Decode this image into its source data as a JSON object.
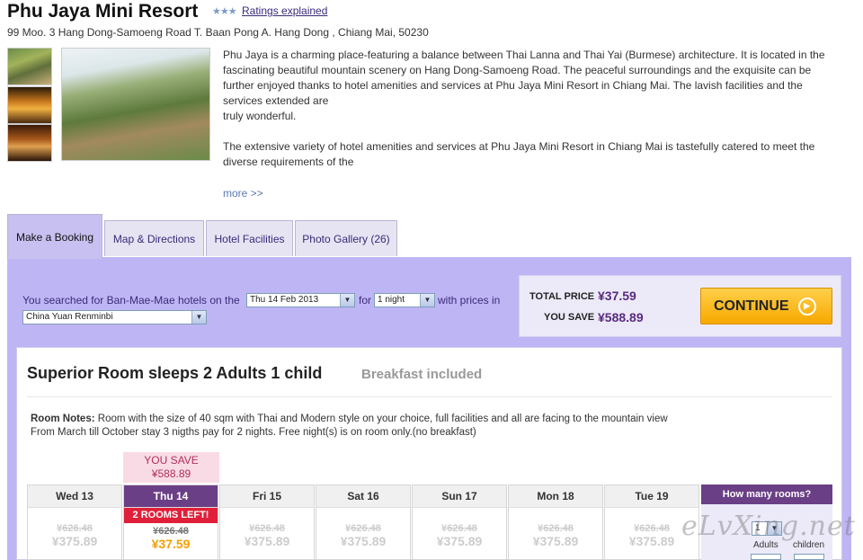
{
  "hotel": {
    "name": "Phu Jaya Mini Resort",
    "stars": "★★★",
    "ratings_link": "Ratings explained",
    "address": "99 Moo. 3 Hang Dong-Samoeng Road T. Baan Pong A. Hang Dong , Chiang Mai, 50230",
    "description_1": "Phu Jaya is a charming place-featuring a balance between Thai Lanna and Thai Yai (Burmese) architecture. It is located in the fascinating beautiful mountain scenery on Hang Dong-Samoeng Road. The peaceful surroundings and the exquisite can be further enjoyed thanks to hotel amenities and services at Phu Jaya Mini Resort in Chiang Mai. The lavish facilities and the services extended are",
    "description_1b": "truly wonderful.",
    "description_2": "The extensive variety of hotel amenities and services at Phu Jaya Mini Resort in Chiang Mai is tastefully catered to meet the diverse requirements of the",
    "more_link": "more >>"
  },
  "tabs": [
    {
      "label": "Make a Booking"
    },
    {
      "label": "Map & Directions"
    },
    {
      "label": "Hotel Facilities"
    },
    {
      "label": "Photo Gallery (26)"
    }
  ],
  "search": {
    "prefix": "You searched for Ban-Mae-Mae hotels on the",
    "date_value": "Thu 14 Feb 2013",
    "for_text": "for",
    "nights_value": "1 night",
    "suffix": "with prices in",
    "currency_value": "China Yuan Renminbi"
  },
  "pricing": {
    "total_label": "TOTAL PRICE",
    "total_value": "¥37.59",
    "save_label": "YOU SAVE",
    "save_value": "¥588.89",
    "continue_label": "CONTINUE",
    "continue_icon": "play-circle-icon"
  },
  "room": {
    "title": "Superior Room sleeps 2 Adults 1 child",
    "breakfast": "Breakfast included",
    "notes_label": "Room Notes:",
    "notes_text": "Room with the size of 40 sqm with Thai and Modern style on your choice, full facilities and all are facing to the mountain view",
    "notes_text_2": "From March till October stay 3 nigths pay for 2 nights. Free night(s) is on room only.(no breakfast)"
  },
  "selected_day": {
    "yousave_label": "YOU SAVE",
    "yousave_value": "¥588.89",
    "rooms_left": "2 ROOMS LEFT!"
  },
  "days": [
    {
      "label": "Wed 13",
      "old": "¥626.48",
      "new": "¥375.89"
    },
    {
      "label": "Thu 14",
      "old": "¥626.48",
      "new": "¥37.59"
    },
    {
      "label": "Fri 15",
      "old": "¥626.48",
      "new": "¥375.89"
    },
    {
      "label": "Sat 16",
      "old": "¥626.48",
      "new": "¥375.89"
    },
    {
      "label": "Sun 17",
      "old": "¥626.48",
      "new": "¥375.89"
    },
    {
      "label": "Mon 18",
      "old": "¥626.48",
      "new": "¥375.89"
    },
    {
      "label": "Tue 19",
      "old": "¥626.48",
      "new": "¥375.89"
    }
  ],
  "rooms_selector": {
    "header": "How many rooms?",
    "value": "1",
    "adults_label": "Adults",
    "children_label": "children"
  },
  "watermark": "eLvXing.net"
}
